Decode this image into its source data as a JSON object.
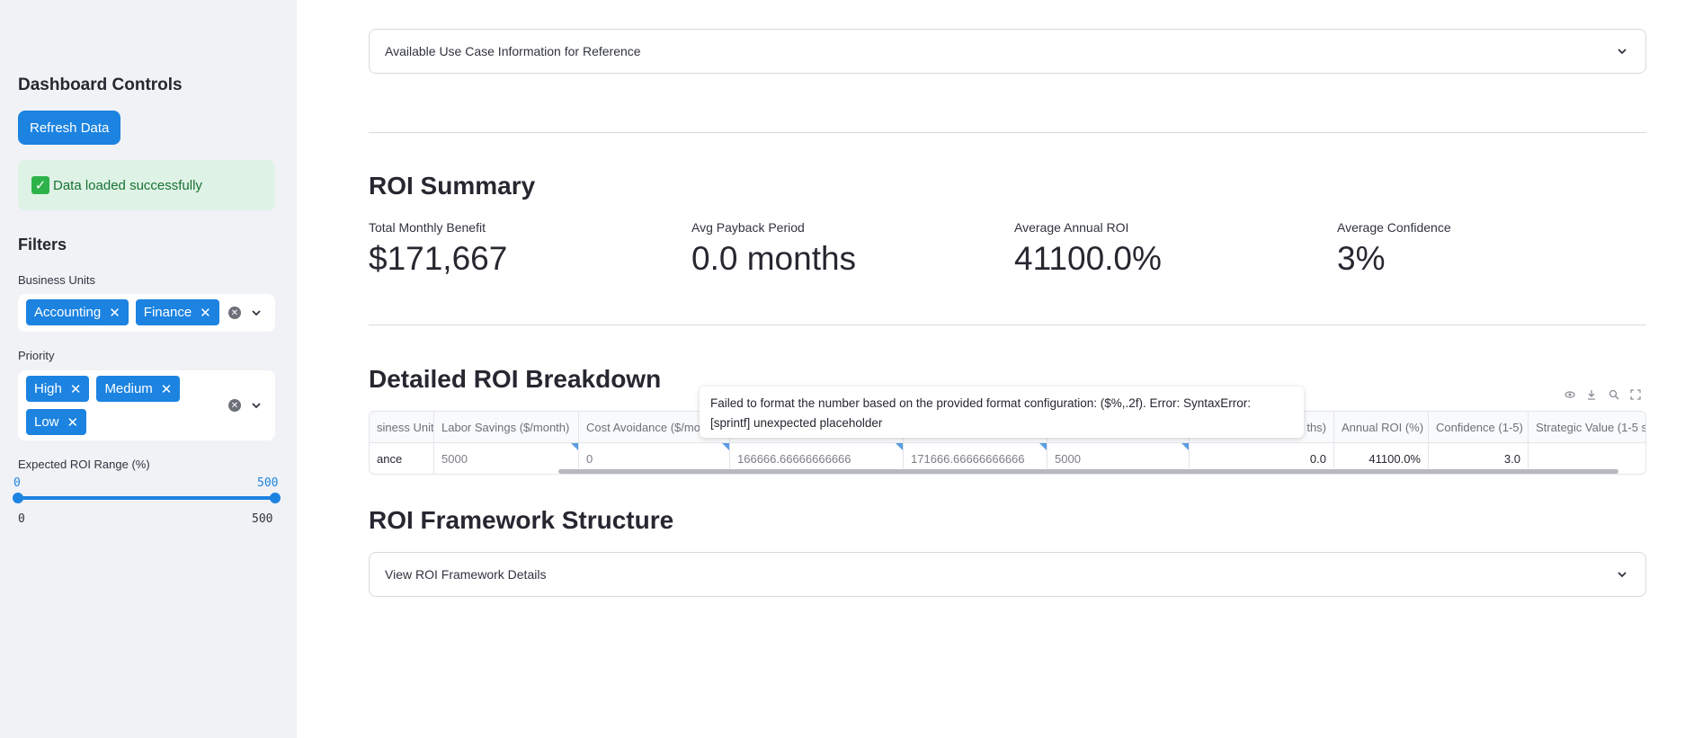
{
  "sidebar": {
    "title": "Dashboard Controls",
    "refresh_button": "Refresh Data",
    "success_message": "Data loaded successfully",
    "filters_heading": "Filters",
    "business_units": {
      "label": "Business Units",
      "selected": [
        "Accounting",
        "Finance"
      ]
    },
    "priority": {
      "label": "Priority",
      "selected": [
        "High",
        "Medium",
        "Low"
      ]
    },
    "roi_range": {
      "label": "Expected ROI Range (%)",
      "low": "0",
      "high": "500",
      "min": "0",
      "max": "500"
    }
  },
  "main": {
    "use_case_expander": "Available Use Case Information for Reference",
    "roi_summary": {
      "title": "ROI Summary",
      "metrics": [
        {
          "label": "Total Monthly Benefit",
          "value": "$171,667"
        },
        {
          "label": "Avg Payback Period",
          "value": "0.0 months"
        },
        {
          "label": "Average Annual ROI",
          "value": "41100.0%"
        },
        {
          "label": "Average Confidence",
          "value": "3%"
        }
      ]
    },
    "breakdown": {
      "title": "Detailed ROI Breakdown",
      "tooltip": "Failed to format the number based on the provided format configuration: ($%,.2f). Error: SyntaxError: [sprintf] unexpected placeholder",
      "headers": [
        "siness Unit",
        "Labor Savings ($/month)",
        "Cost Avoidance ($/mo",
        "",
        "",
        "",
        "ths)",
        "Annual ROI (%)",
        "Confidence (1-5)",
        "Strategic Value (1-5 sc"
      ],
      "row": [
        "ance",
        "5000",
        "0",
        "166666.66666666666",
        "171666.66666666666",
        "5000",
        "0.0",
        "41100.0%",
        "3.0",
        ""
      ]
    },
    "framework": {
      "title": "ROI Framework Structure",
      "expander": "View ROI Framework Details"
    }
  },
  "colors": {
    "accent": "#1c83e1",
    "sidebar_bg": "#f0f2f6",
    "success_bg": "#dff2e6",
    "success_text": "#177233"
  }
}
